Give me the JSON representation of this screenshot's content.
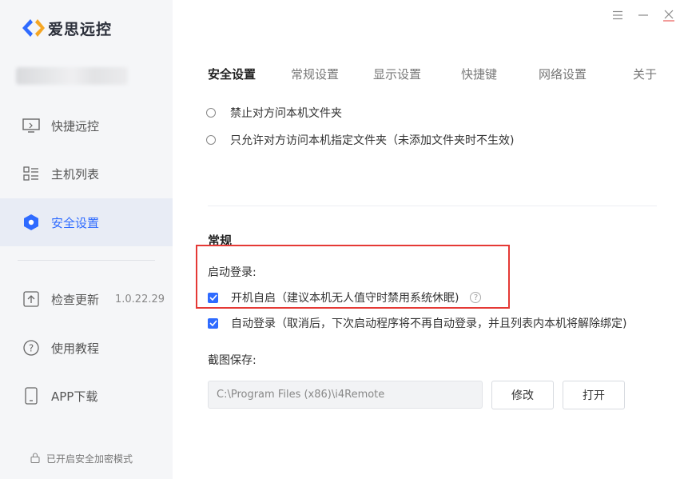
{
  "app": {
    "title": "爱思远控"
  },
  "sidebar": {
    "items": [
      {
        "label": "快捷远控",
        "icon": "monitor-icon"
      },
      {
        "label": "主机列表",
        "icon": "list-icon"
      },
      {
        "label": "安全设置",
        "icon": "shield-icon",
        "active": true
      },
      {
        "label": "检查更新",
        "icon": "upload-icon",
        "version": "1.0.22.29"
      },
      {
        "label": "使用教程",
        "icon": "help-circle-icon"
      },
      {
        "label": "APP下载",
        "icon": "phone-icon"
      }
    ],
    "footer": "已开启安全加密模式"
  },
  "tabs": [
    {
      "label": "安全设置",
      "active": true
    },
    {
      "label": "常规设置"
    },
    {
      "label": "显示设置"
    },
    {
      "label": "快捷键"
    },
    {
      "label": "网络设置"
    },
    {
      "label": "关于"
    }
  ],
  "file_access": {
    "options": [
      {
        "label": "禁止对方问本机文件夹",
        "selected": false
      },
      {
        "label": "只允许对方访问本机指定文件夹（未添加文件夹时不生效)",
        "selected": false
      }
    ]
  },
  "general": {
    "title": "常规",
    "startup_label": "启动登录:",
    "autostart": {
      "label": "开机自启（建议本机无人值守时禁用系统休眠)",
      "checked": true
    },
    "autologin": {
      "label": "自动登录（取消后，下次启动程序将不再自动登录，并且列表内本机将解除绑定)",
      "checked": true
    },
    "screenshot_label": "截图保存:",
    "screenshot_path": "C:\\Program Files (x86)\\i4Remote",
    "modify_button": "修改",
    "open_button": "打开"
  },
  "colors": {
    "accent": "#2f6bff",
    "highlight_box": "#e53935",
    "sidebar_bg": "#f5f6f8"
  }
}
